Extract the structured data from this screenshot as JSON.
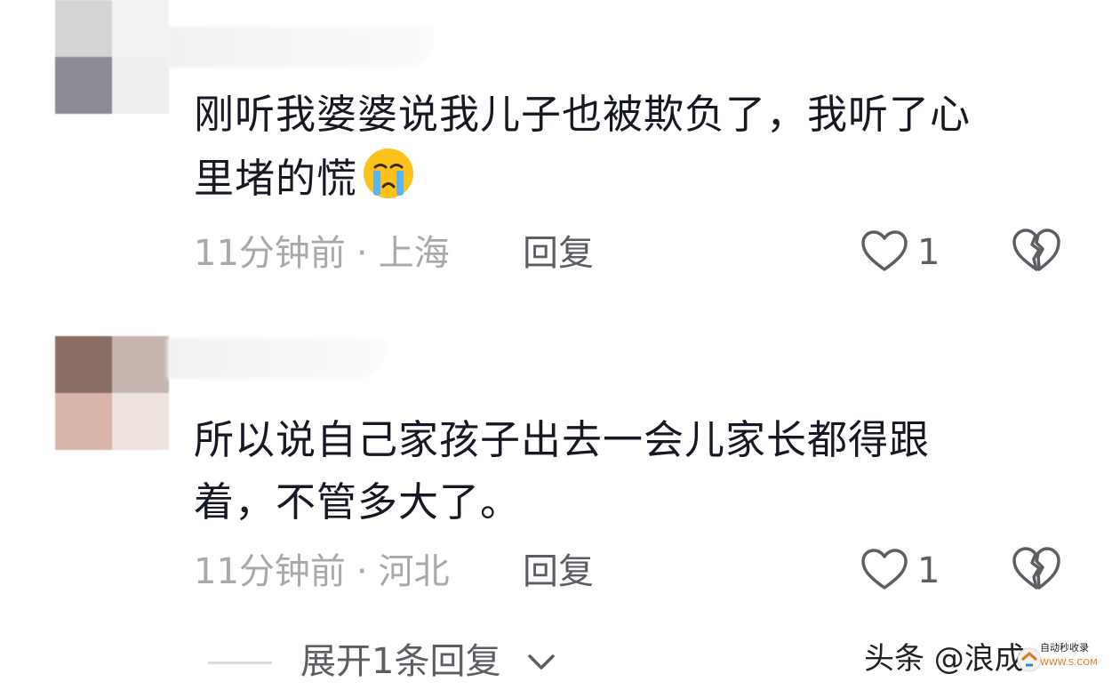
{
  "comments": [
    {
      "text_line1": "刚听我婆婆说我儿子也被欺负了，我听了心",
      "text_line2": "里堵的慌",
      "emoji": "crying-face-icon",
      "time": "11分钟前",
      "separator": "·",
      "location": "上海",
      "reply_label": "回复",
      "like_count": "1"
    },
    {
      "text_line1": "所以说自己家孩子出去一会儿家长都得跟",
      "text_line2": "着，不管多大了。",
      "time": "11分钟前",
      "separator": "·",
      "location": "河北",
      "reply_label": "回复",
      "like_count": "1"
    }
  ],
  "expand_replies_label": "展开1条回复",
  "watermark": {
    "text": "头条 @浪成",
    "logo_text": "自动秒收录",
    "logo_sub": "WWW.S.COM"
  },
  "colors": {
    "text": "#161823",
    "meta": "#a8a9ad",
    "action": "#5d5e64"
  },
  "icons": {
    "like": "heart-outline-icon",
    "dislike": "broken-heart-icon",
    "expand": "chevron-down-icon"
  }
}
